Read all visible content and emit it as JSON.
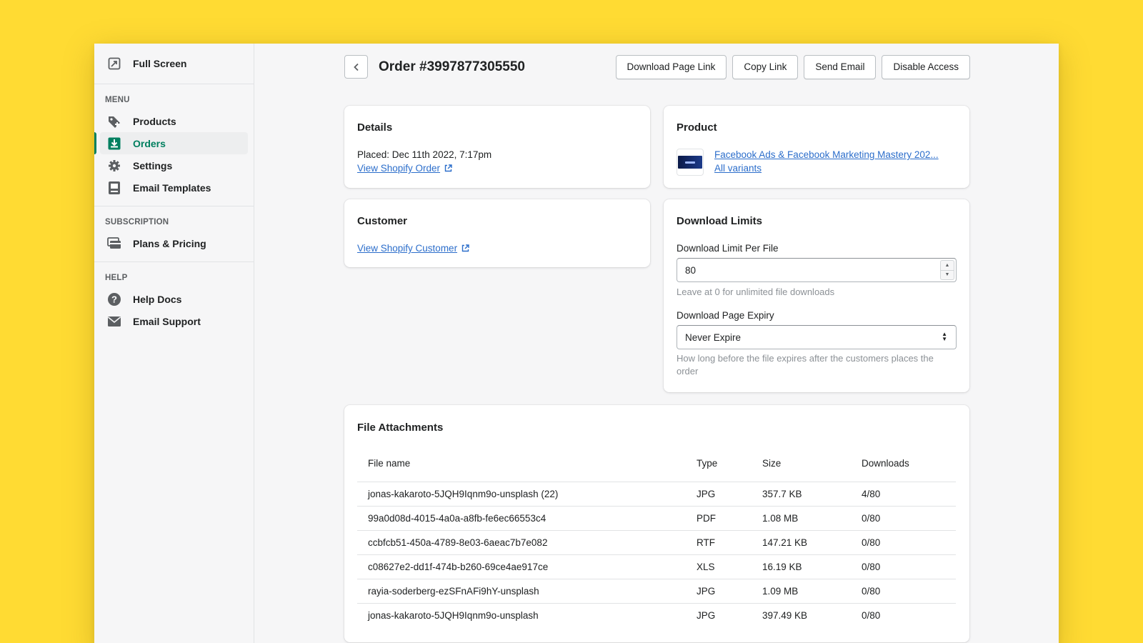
{
  "sidebar": {
    "fullscreen_label": "Full Screen",
    "sections": [
      {
        "heading": "MENU",
        "items": [
          {
            "label": "Products",
            "icon": "tag-icon"
          },
          {
            "label": "Orders",
            "icon": "orders-download-icon",
            "active": true
          },
          {
            "label": "Settings",
            "icon": "gear-icon"
          },
          {
            "label": "Email Templates",
            "icon": "email-template-icon"
          }
        ]
      },
      {
        "heading": "SUBSCRIPTION",
        "items": [
          {
            "label": "Plans & Pricing",
            "icon": "plans-icon"
          }
        ]
      },
      {
        "heading": "HELP",
        "items": [
          {
            "label": "Help Docs",
            "icon": "question-circle-icon"
          },
          {
            "label": "Email Support",
            "icon": "envelope-icon"
          }
        ]
      }
    ]
  },
  "header": {
    "title": "Order #3997877305550",
    "actions": [
      "Download Page Link",
      "Copy Link",
      "Send Email",
      "Disable Access"
    ]
  },
  "details": {
    "title": "Details",
    "placed": "Placed: Dec 11th 2022, 7:17pm",
    "shopify_order_link": "View Shopify Order"
  },
  "product": {
    "title": "Product",
    "name": "Facebook Ads & Facebook Marketing Mastery 202...",
    "variants": "All variants"
  },
  "customer": {
    "title": "Customer",
    "shopify_customer_link": "View Shopify Customer"
  },
  "download_limits": {
    "title": "Download Limits",
    "limit_label": "Download Limit Per File",
    "limit_value": "80",
    "limit_help": "Leave at 0 for unlimited file downloads",
    "expiry_label": "Download Page Expiry",
    "expiry_value": "Never Expire",
    "expiry_help": "How long before the file expires after the customers places the order"
  },
  "attachments": {
    "title": "File Attachments",
    "columns": [
      "File name",
      "Type",
      "Size",
      "Downloads"
    ],
    "rows": [
      [
        "jonas-kakaroto-5JQH9Iqnm9o-unsplash (22)",
        "JPG",
        "357.7 KB",
        "4/80"
      ],
      [
        "99a0d08d-4015-4a0a-a8fb-fe6ec66553c4",
        "PDF",
        "1.08 MB",
        "0/80"
      ],
      [
        "ccbfcb51-450a-4789-8e03-6aeac7b7e082",
        "RTF",
        "147.21 KB",
        "0/80"
      ],
      [
        "c08627e2-dd1f-474b-b260-69ce4ae917ce",
        "XLS",
        "16.19 KB",
        "0/80"
      ],
      [
        "rayia-soderberg-ezSFnAFi9hY-unsplash",
        "JPG",
        "1.09 MB",
        "0/80"
      ],
      [
        "jonas-kakaroto-5JQH9Iqnm9o-unsplash",
        "JPG",
        "397.49 KB",
        "0/80"
      ]
    ]
  },
  "colors": {
    "background": "#FFDB33",
    "accent": "#008060",
    "link": "#2C6ECB"
  }
}
